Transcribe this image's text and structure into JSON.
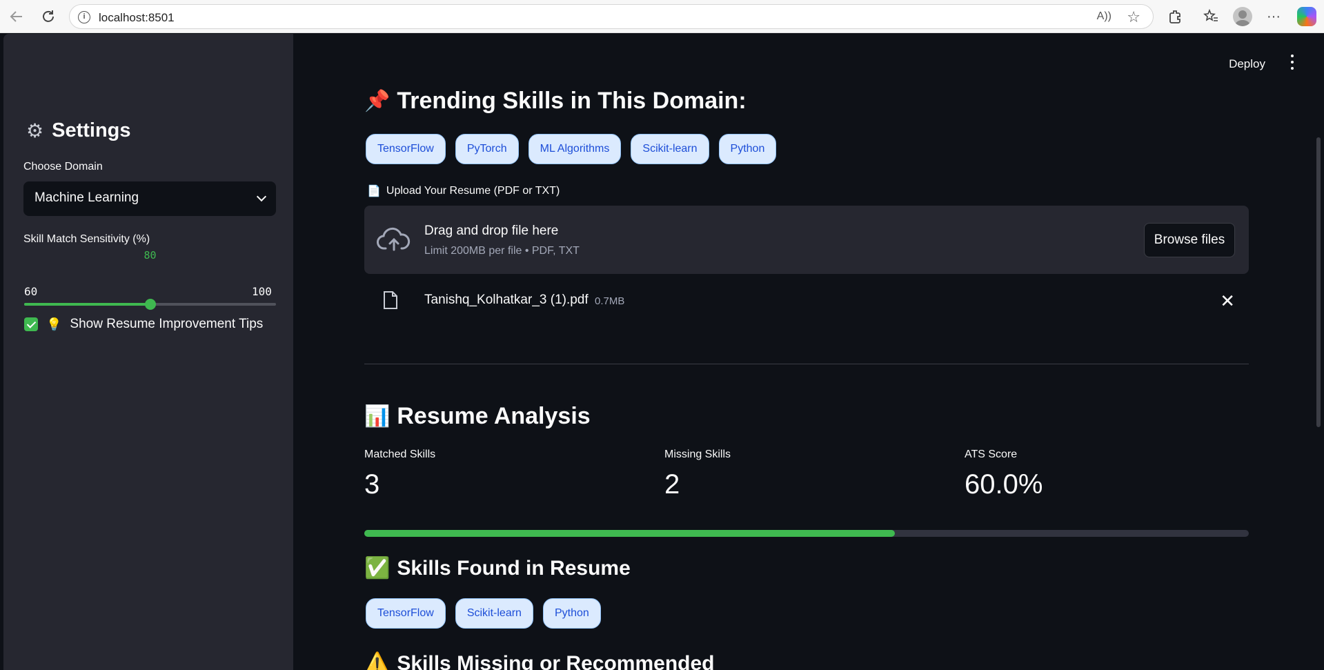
{
  "browser": {
    "url": "localhost:8501",
    "read_aloud_label": "A)"
  },
  "header": {
    "deploy_label": "Deploy"
  },
  "sidebar": {
    "title": "Settings",
    "domain_label": "Choose Domain",
    "domain_value": "Machine Learning",
    "slider_label": "Skill Match Sensitivity (%)",
    "slider_value": "80",
    "slider_min": "60",
    "slider_max": "100",
    "slider_fraction": 0.5,
    "tips_checked": true,
    "tips_label": "Show Resume Improvement Tips"
  },
  "trending": {
    "title": "Trending Skills in This Domain:",
    "skills": [
      "TensorFlow",
      "PyTorch",
      "ML Algorithms",
      "Scikit-learn",
      "Python"
    ]
  },
  "upload": {
    "label": "Upload Your Resume (PDF or TXT)",
    "drop_title": "Drag and drop file here",
    "drop_sub": "Limit 200MB per file • PDF, TXT",
    "browse_label": "Browse files",
    "file_name": "Tanishq_Kolhatkar_3 (1).pdf",
    "file_size": "0.7MB"
  },
  "analysis": {
    "title": "Resume Analysis",
    "matched_label": "Matched Skills",
    "matched_value": "3",
    "missing_label": "Missing Skills",
    "missing_value": "2",
    "ats_label": "ATS Score",
    "ats_value": "60.0%",
    "ats_fraction": 0.6
  },
  "found": {
    "title": "Skills Found in Resume",
    "skills": [
      "TensorFlow",
      "Scikit-learn",
      "Python"
    ]
  },
  "missing": {
    "title": "Skills Missing or Recommended"
  },
  "colors": {
    "accent": "#3fb950",
    "sidebar_bg": "#262730",
    "main_bg": "#0e1117",
    "chip_bg": "#dbeafe",
    "chip_text": "#1d4ed8"
  }
}
